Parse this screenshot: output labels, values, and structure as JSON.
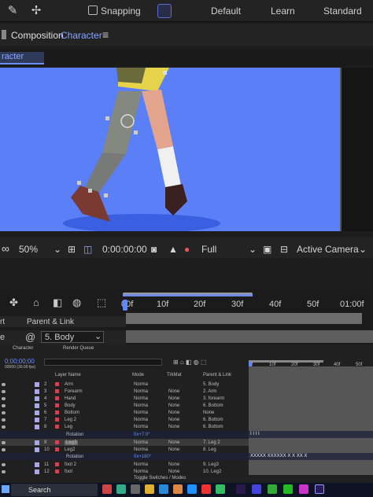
{
  "toolbar": {
    "snapping_label": "Snapping",
    "workspaces": [
      "Default",
      "Learn",
      "Standard"
    ]
  },
  "composition": {
    "panel_label": "Composition",
    "name": "Character",
    "tab_label": "racter"
  },
  "viewer_controls": {
    "zoom": "50%",
    "timecode": "0:00:00:00",
    "resolution": "Full",
    "camera": "Active Camera"
  },
  "timeline": {
    "ruler_ticks": [
      "00f",
      "10f",
      "20f",
      "30f",
      "40f",
      "50f",
      "01:00f"
    ],
    "header_left": "rt",
    "parent_link_label": "Parent & Link",
    "big_row_prefix": "e",
    "big_row_parent": "5. Body",
    "small": {
      "tab_name": "Character",
      "render_queue": "Render Queue",
      "timecode": "0;00;00;00",
      "frame_sub": "00000 (30.00 fps)",
      "ruler": [
        "0f",
        "10f",
        "20f",
        "30f",
        "40f",
        "50f"
      ],
      "col_layer_name": "Layer Name",
      "col_mode": "Mode",
      "col_trkmat": "TrkMat",
      "col_parent": "Parent & Link",
      "layers": [
        {
          "num": "2",
          "name": "Arm",
          "mode": "Norma",
          "trk": "",
          "parent": "5. Body"
        },
        {
          "num": "3",
          "name": "Forearm",
          "mode": "Norma",
          "trk": "None",
          "parent": "2. Arm"
        },
        {
          "num": "4",
          "name": "Hand",
          "mode": "Norma",
          "trk": "None",
          "parent": "3. forearm"
        },
        {
          "num": "5",
          "name": "Body",
          "mode": "Norma",
          "trk": "None",
          "parent": "6. Bottom"
        },
        {
          "num": "6",
          "name": "Bottom",
          "mode": "Norma",
          "trk": "None",
          "parent": "None"
        },
        {
          "num": "7",
          "name": "Leg 2",
          "mode": "Norma",
          "trk": "None",
          "parent": "6. Bottom"
        },
        {
          "num": "8",
          "name": "Leg",
          "mode": "Norma",
          "trk": "None",
          "parent": "6. Bottom"
        },
        {
          "num": "",
          "name": "Rotation",
          "mode": "0x+7.0°",
          "trk": "",
          "parent": ""
        },
        {
          "num": "9",
          "name": "Leg3",
          "mode": "Norma",
          "trk": "None",
          "parent": "7. Leg 2"
        },
        {
          "num": "10",
          "name": "Leg2",
          "mode": "Norma",
          "trk": "None",
          "parent": "8. Leg"
        },
        {
          "num": "",
          "name": "Rotation",
          "mode": "0x+180°",
          "trk": "",
          "parent": ""
        },
        {
          "num": "11",
          "name": "foot 2",
          "mode": "Norma",
          "trk": "None",
          "parent": "9. Leg3"
        },
        {
          "num": "12",
          "name": "foot",
          "mode": "Norma",
          "trk": "None",
          "parent": "10. Leg2"
        }
      ],
      "toggle_label": "Toggle Switches / Modes",
      "keyframe_row_a": "I         I                                       I   I",
      "keyframe_row_b": "XXXXX  XXXXXX   X    X   XX   X"
    }
  },
  "taskbar": {
    "search_placeholder": "Search"
  },
  "colors": {
    "viewer_bg": "#5b7ff7",
    "accent": "#6b8cff",
    "shadow": "#3a5fe0"
  }
}
